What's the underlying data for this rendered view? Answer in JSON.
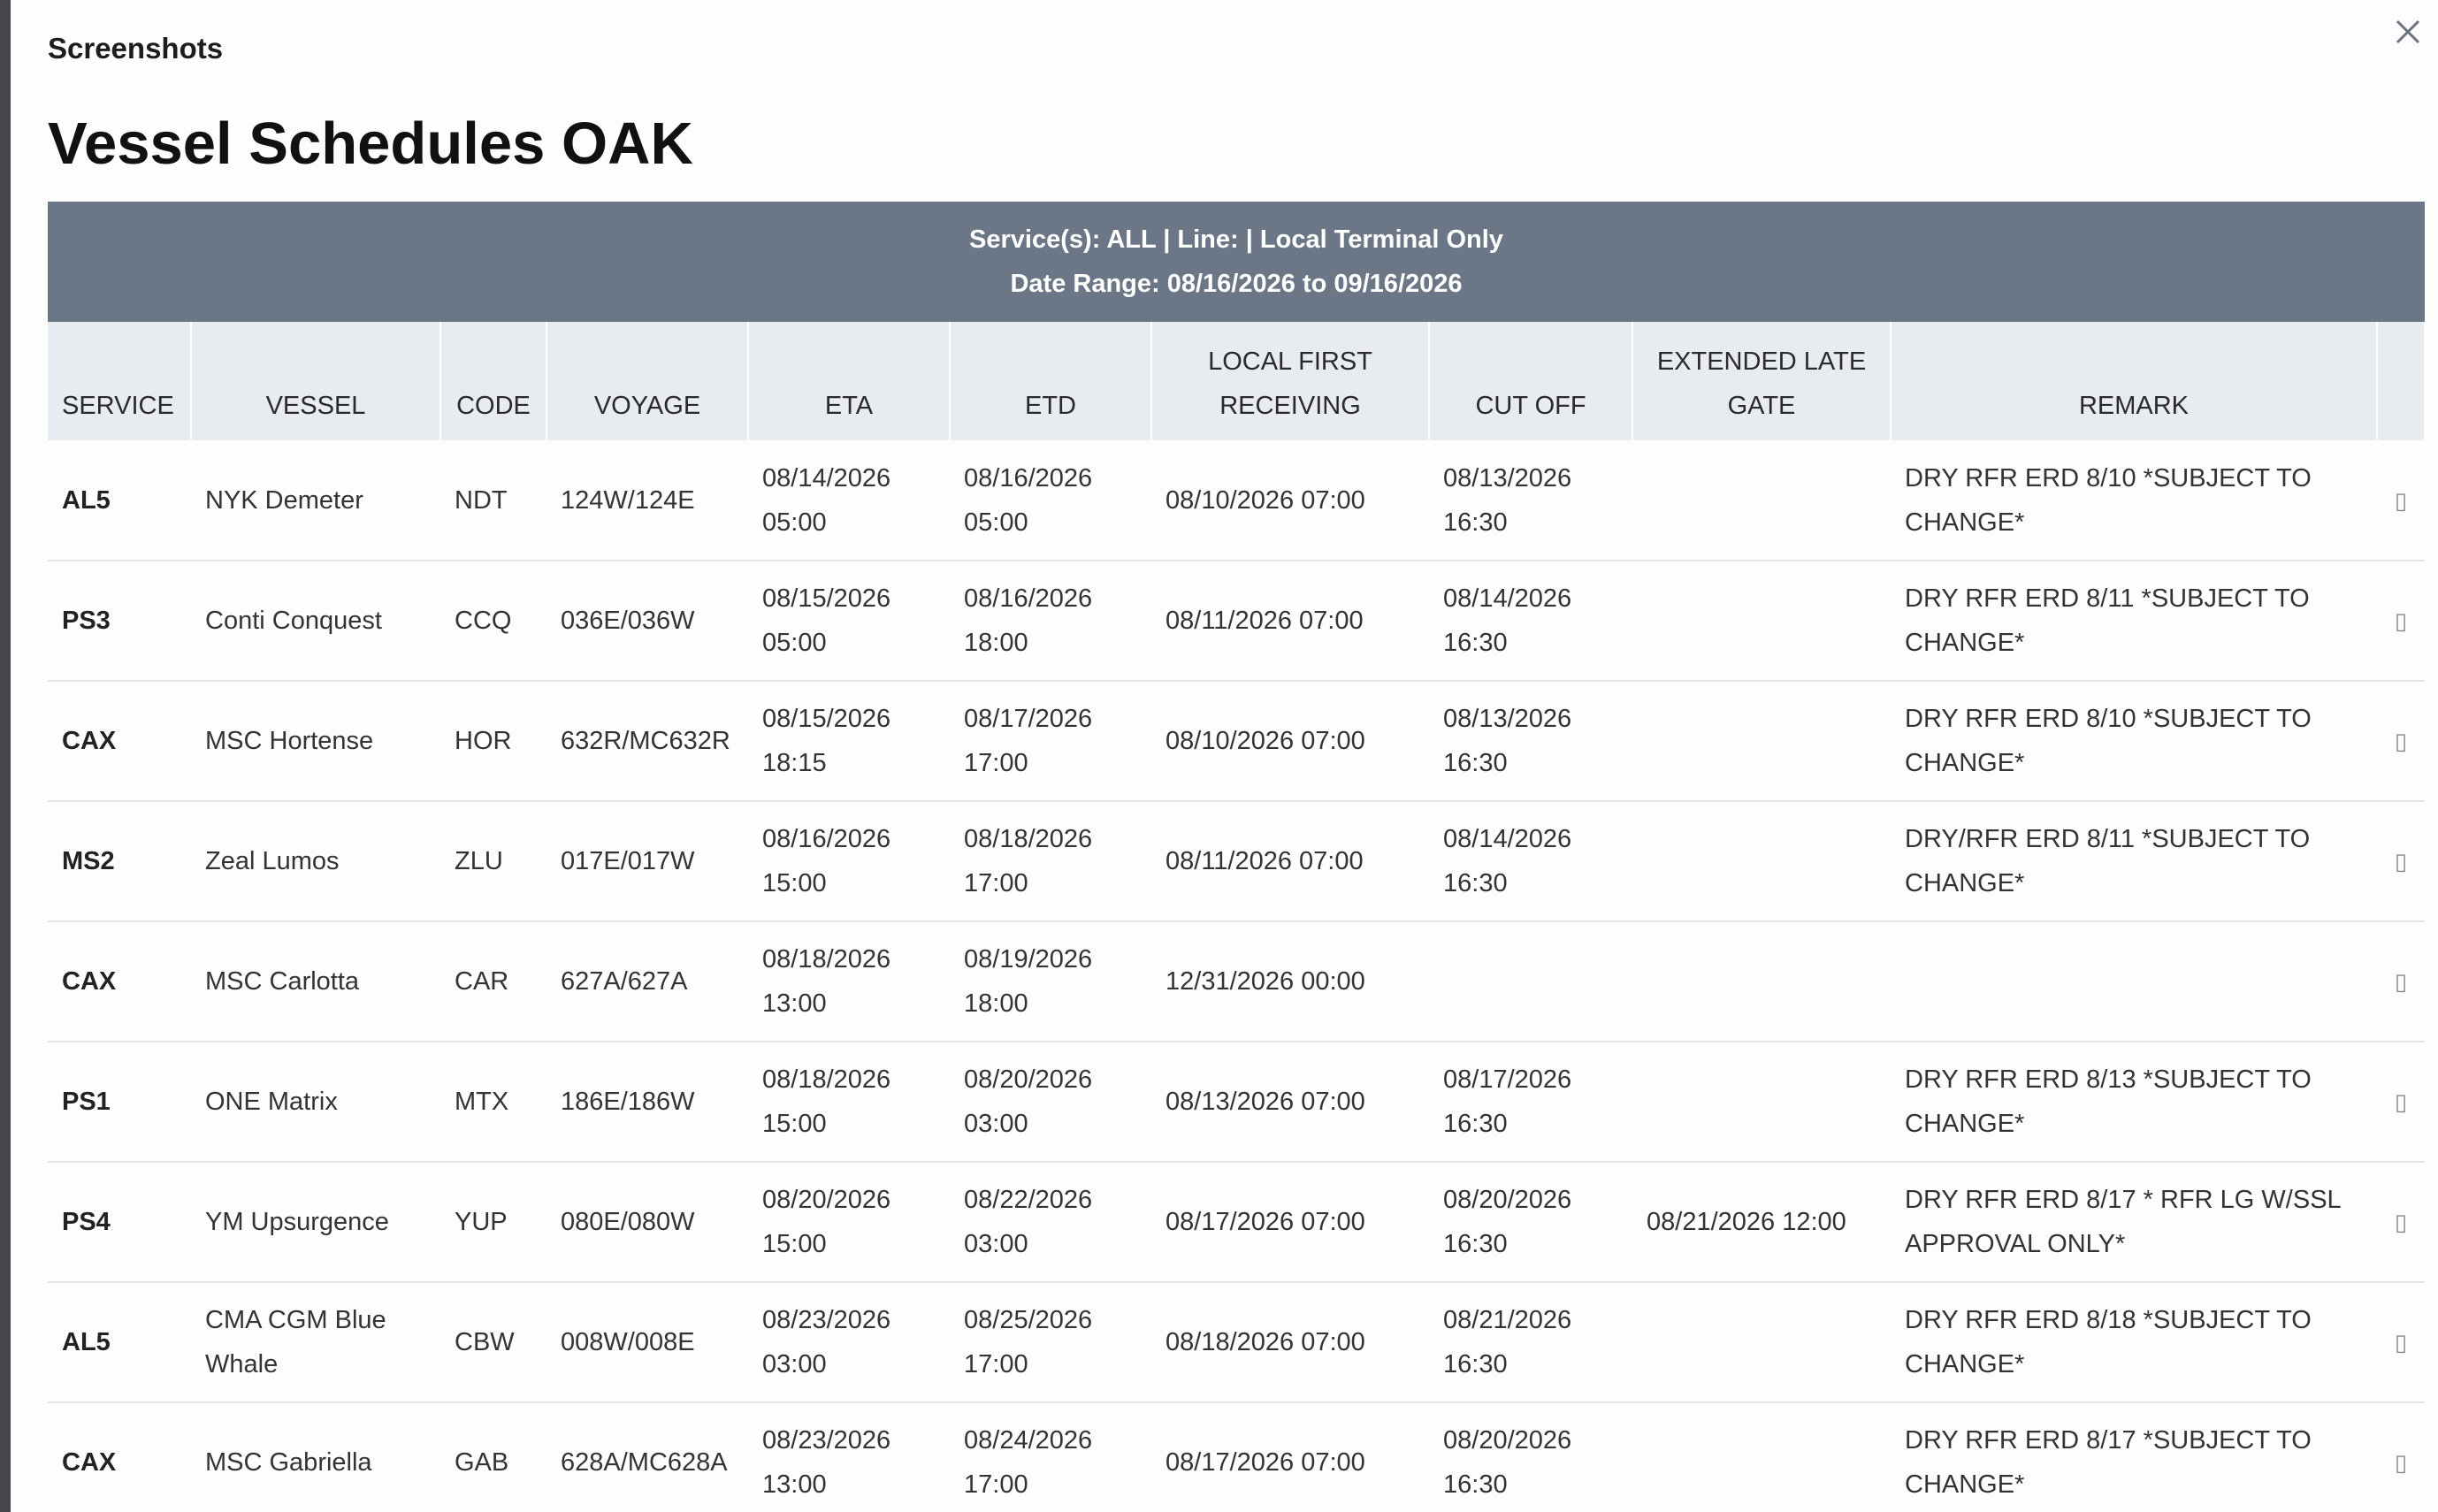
{
  "modal": {
    "header_label": "Screenshots"
  },
  "page": {
    "title": "Vessel Schedules OAK"
  },
  "banner": {
    "line1": "Service(s): ALL | Line: | Local Terminal Only",
    "line2": "Date Range: 08/16/2026 to 09/16/2026"
  },
  "columns": {
    "service": "SERVICE",
    "vessel": "VESSEL",
    "code": "CODE",
    "voyage": "VOYAGE",
    "eta": "ETA",
    "etd": "ETD",
    "lfr_1": "LOCAL FIRST",
    "lfr_2": "RECEIVING",
    "cutoff": "CUT OFF",
    "elg_1": "EXTENDED LATE",
    "elg_2": "GATE",
    "remark": "REMARK"
  },
  "action_icon": "▯",
  "rows": [
    {
      "service": "AL5",
      "vessel": "NYK Demeter",
      "code": "NDT",
      "voyage": "124W/124E",
      "eta_date": "08/14/2026",
      "eta_time": "05:00",
      "etd_date": "08/16/2026",
      "etd_time": "05:00",
      "lfr": "08/10/2026 07:00",
      "cut_date": "08/13/2026",
      "cut_time": "16:30",
      "elg": "",
      "remark_1": "DRY RFR ERD 8/10 *SUBJECT TO",
      "remark_2": "CHANGE*"
    },
    {
      "service": "PS3",
      "vessel": "Conti Conquest",
      "code": "CCQ",
      "voyage": "036E/036W",
      "eta_date": "08/15/2026",
      "eta_time": "05:00",
      "etd_date": "08/16/2026",
      "etd_time": "18:00",
      "lfr": "08/11/2026 07:00",
      "cut_date": "08/14/2026",
      "cut_time": "16:30",
      "elg": "",
      "remark_1": "DRY RFR ERD 8/11 *SUBJECT TO",
      "remark_2": "CHANGE*"
    },
    {
      "service": "CAX",
      "vessel": "MSC Hortense",
      "code": "HOR",
      "voyage": "632R/MC632R",
      "eta_date": "08/15/2026",
      "eta_time": "18:15",
      "etd_date": "08/17/2026",
      "etd_time": "17:00",
      "lfr": "08/10/2026 07:00",
      "cut_date": "08/13/2026",
      "cut_time": "16:30",
      "elg": "",
      "remark_1": "DRY RFR ERD 8/10 *SUBJECT TO",
      "remark_2": "CHANGE*"
    },
    {
      "service": "MS2",
      "vessel": "Zeal Lumos",
      "code": "ZLU",
      "voyage": "017E/017W",
      "eta_date": "08/16/2026",
      "eta_time": "15:00",
      "etd_date": "08/18/2026",
      "etd_time": "17:00",
      "lfr": "08/11/2026 07:00",
      "cut_date": "08/14/2026",
      "cut_time": "16:30",
      "elg": "",
      "remark_1": "DRY/RFR ERD 8/11 *SUBJECT TO",
      "remark_2": "CHANGE*"
    },
    {
      "service": "CAX",
      "vessel": "MSC Carlotta",
      "code": "CAR",
      "voyage": "627A/627A",
      "eta_date": "08/18/2026",
      "eta_time": "13:00",
      "etd_date": "08/19/2026",
      "etd_time": "18:00",
      "lfr": "12/31/2026 00:00",
      "cut_date": "",
      "cut_time": "",
      "elg": "",
      "remark_1": "",
      "remark_2": ""
    },
    {
      "service": "PS1",
      "vessel": "ONE Matrix",
      "code": "MTX",
      "voyage": "186E/186W",
      "eta_date": "08/18/2026",
      "eta_time": "15:00",
      "etd_date": "08/20/2026",
      "etd_time": "03:00",
      "lfr": "08/13/2026 07:00",
      "cut_date": "08/17/2026",
      "cut_time": "16:30",
      "elg": "",
      "remark_1": "DRY RFR ERD 8/13 *SUBJECT TO",
      "remark_2": "CHANGE*"
    },
    {
      "service": "PS4",
      "vessel": "YM Upsurgence",
      "code": "YUP",
      "voyage": "080E/080W",
      "eta_date": "08/20/2026",
      "eta_time": "15:00",
      "etd_date": "08/22/2026",
      "etd_time": "03:00",
      "lfr": "08/17/2026 07:00",
      "cut_date": "08/20/2026",
      "cut_time": "16:30",
      "elg": "08/21/2026 12:00",
      "remark_1": "DRY RFR ERD 8/17 * RFR LG W/SSL",
      "remark_2": "APPROVAL ONLY*"
    },
    {
      "service": "AL5",
      "vessel": "CMA CGM Blue Whale",
      "code": "CBW",
      "voyage": "008W/008E",
      "eta_date": "08/23/2026",
      "eta_time": "03:00",
      "etd_date": "08/25/2026",
      "etd_time": "17:00",
      "lfr": "08/18/2026 07:00",
      "cut_date": "08/21/2026",
      "cut_time": "16:30",
      "elg": "",
      "remark_1": "DRY RFR ERD 8/18 *SUBJECT TO",
      "remark_2": "CHANGE*"
    },
    {
      "service": "CAX",
      "vessel": "MSC Gabriella",
      "code": "GAB",
      "voyage": "628A/MC628A",
      "eta_date": "08/23/2026",
      "eta_time": "13:00",
      "etd_date": "08/24/2026",
      "etd_time": "17:00",
      "lfr": "08/17/2026 07:00",
      "cut_date": "08/20/2026",
      "cut_time": "16:30",
      "elg": "",
      "remark_1": "DRY RFR ERD 8/17 *SUBJECT TO",
      "remark_2": "CHANGE*"
    }
  ]
}
